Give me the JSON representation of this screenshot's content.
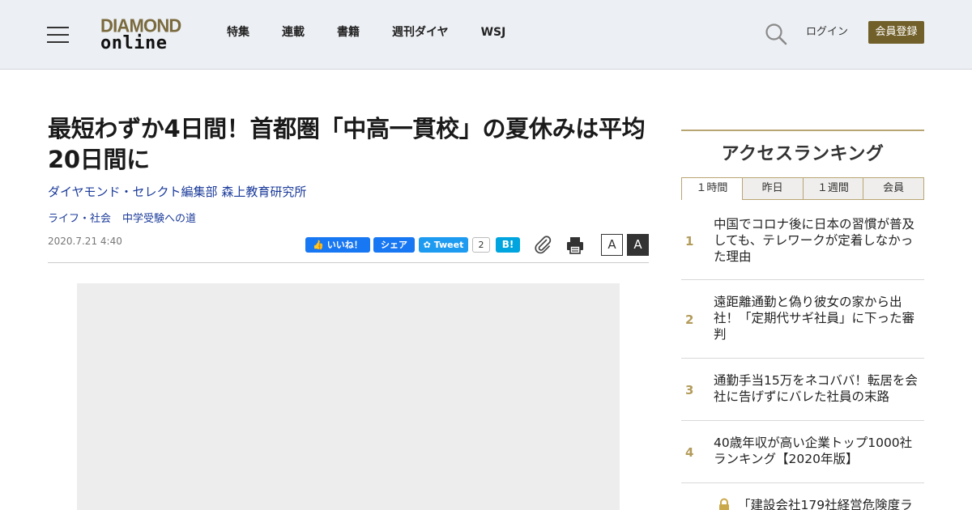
{
  "header": {
    "logo": {
      "line1": "DIAMOND",
      "line2": "online"
    },
    "nav": [
      "特集",
      "連載",
      "書籍",
      "週刊ダイヤ",
      "WSJ"
    ],
    "login": "ログイン",
    "register": "会員登録",
    "colors": {
      "background": "#eceff3",
      "register_button": "#72602a",
      "logo_gold": "#7a6a3e"
    }
  },
  "article": {
    "title": "最短わずか4日間！首都圏「中高一貫校」の夏休みは平均20日間に",
    "author": "ダイヤモンド・セレクト編集部 森上教育研究所",
    "tags": [
      "ライフ・社会",
      "中学受験への道"
    ],
    "date": "2020.7.21 4:40",
    "share": {
      "like": "いいね！",
      "share": "シェア",
      "tweet": "Tweet",
      "tweet_count": "2",
      "hatena": "B!"
    },
    "font_size": {
      "small": "A",
      "large": "A"
    }
  },
  "sidebar": {
    "heading": "アクセスランキング",
    "tabs": [
      "１時間",
      "昨日",
      "１週間",
      "会員"
    ],
    "active_tab": "１時間",
    "ranking": [
      {
        "rank": "1",
        "title": "中国でコロナ後に日本の習慣が普及しても、テレワークが定着しなかった理由"
      },
      {
        "rank": "2",
        "title": "遠距離通勤と偽り彼女の家から出社！「定期代サギ社員」に下った審判"
      },
      {
        "rank": "3",
        "title": "通勤手当15万をネコババ！転居を会社に告げずにバレた社員の末路"
      },
      {
        "rank": "4",
        "title": "40歳年収が高い企業トップ1000社ランキング【2020年版】"
      },
      {
        "rank": "",
        "title": "「建設会社179社経営危険度ラ",
        "locked": true
      }
    ],
    "colors": {
      "accent": "#b8a572",
      "rank": "#b39b5a"
    }
  }
}
